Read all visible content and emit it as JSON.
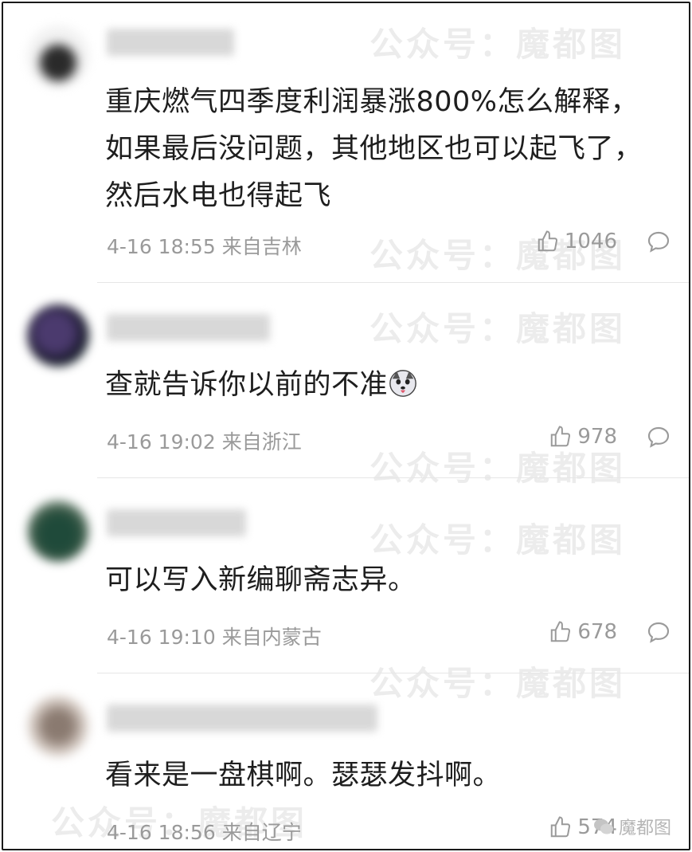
{
  "comments": [
    {
      "text": "重庆燃气四季度利润暴涨800%怎么解释，如果最后没问题，其他地区也可以起飞了，然后水电也得起飞",
      "time": "4-16 18:55",
      "location": "来自吉林",
      "likes": "1046"
    },
    {
      "text": "查就告诉你以前的不准",
      "time": "4-16 19:02",
      "location": "来自浙江",
      "likes": "978"
    },
    {
      "text": "可以写入新编聊斋志异。",
      "time": "4-16 19:10",
      "location": "来自内蒙古",
      "likes": "678"
    },
    {
      "text": "看来是一盘棋啊。瑟瑟发抖啊。",
      "time": "4-16 18:56",
      "location": "来自辽宁",
      "likes": "574"
    }
  ],
  "watermark": {
    "text": "公众号：魔都图",
    "corner_text": "魔都图"
  }
}
